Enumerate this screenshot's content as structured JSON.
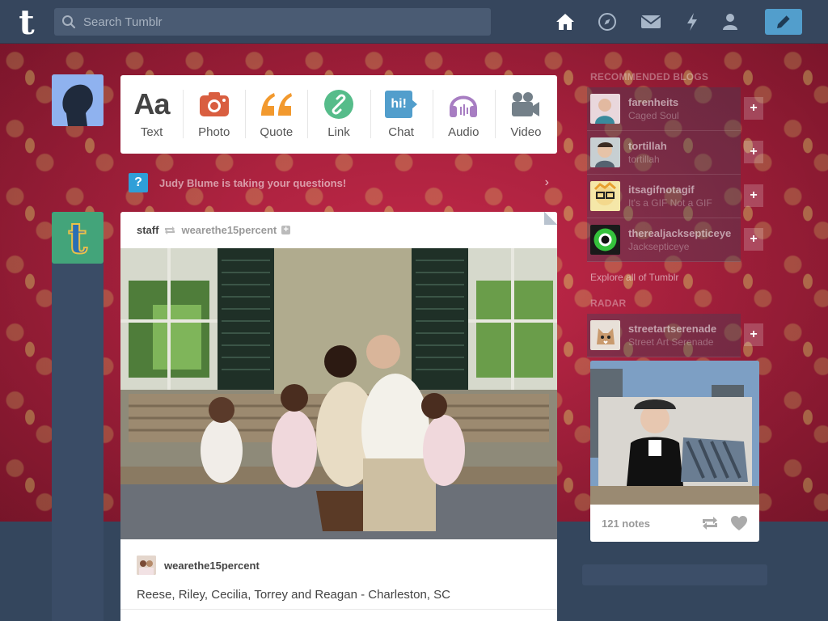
{
  "header": {
    "logo": "t",
    "search_placeholder": "Search Tumblr",
    "compose_label": "compose"
  },
  "postbar": {
    "items": [
      {
        "label": "Text",
        "glyph": "Aa",
        "color": "#444444"
      },
      {
        "label": "Photo",
        "color": "#d95e40"
      },
      {
        "label": "Quote",
        "glyph": "““",
        "color": "#f2992e"
      },
      {
        "label": "Link",
        "color": "#56bc8a"
      },
      {
        "label": "Chat",
        "glyph": "hi!",
        "color": "#529ecc"
      },
      {
        "label": "Audio",
        "color": "#a77dc2"
      },
      {
        "label": "Video",
        "color": "#748089"
      }
    ]
  },
  "ask_banner": {
    "badge": "?",
    "text": "Judy Blume is taking your questions!",
    "chevron": "›"
  },
  "post": {
    "author": "staff",
    "source": "wearethe15percent",
    "follow": "+",
    "caption_author": "wearethe15percent",
    "caption": "Reese, Riley, Cecilia, Torrey and Reagan - Charleston, SC"
  },
  "sidebar": {
    "recommended_heading": "RECOMMENDED BLOGS",
    "recommended": [
      {
        "name": "farenheits",
        "title": "Caged Soul",
        "avatar_color": "#e8d4d8"
      },
      {
        "name": "tortillah",
        "title": "tortillah",
        "avatar_color": "#b8c4c8"
      },
      {
        "name": "itsagifnotagif",
        "title": "It's a GIF Not a GIF",
        "avatar_color": "#f0d860"
      },
      {
        "name": "therealjacksepticeye",
        "title": "Jacksepticeye",
        "avatar_color": "#2ea84a"
      }
    ],
    "explore": "Explore all of Tumblr",
    "radar_heading": "RADAR",
    "radar_blog": {
      "name": "streetartserenade",
      "title": "Street Art Serenade"
    },
    "radar_notes": "121 notes"
  }
}
